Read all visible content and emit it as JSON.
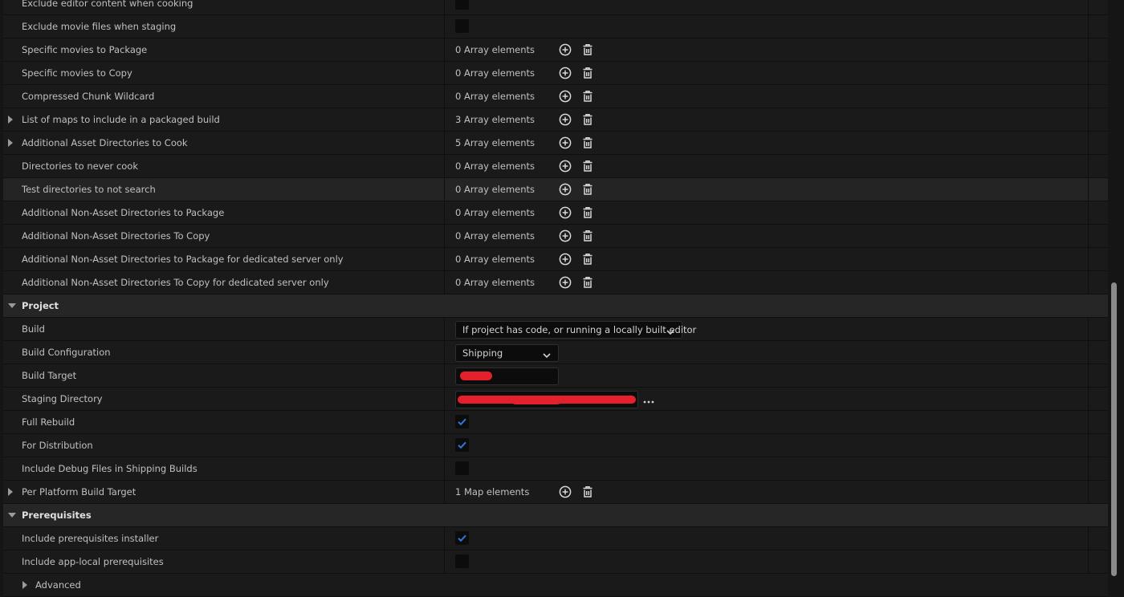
{
  "packaging_rows": [
    {
      "label": "Exclude editor content when cooking",
      "type": "checkbox",
      "checked": false
    },
    {
      "label": "Exclude movie files when staging",
      "type": "checkbox",
      "checked": false
    },
    {
      "label": "Specific movies to Package",
      "type": "array",
      "value": "0 Array elements"
    },
    {
      "label": "Specific movies to Copy",
      "type": "array",
      "value": "0 Array elements"
    },
    {
      "label": "Compressed Chunk Wildcard",
      "type": "array",
      "value": "0 Array elements"
    },
    {
      "label": "List of maps to include in a packaged build",
      "type": "array",
      "value": "3 Array elements",
      "expandable": true
    },
    {
      "label": "Additional Asset Directories to Cook",
      "type": "array",
      "value": "5 Array elements",
      "expandable": true
    },
    {
      "label": "Directories to never cook",
      "type": "array",
      "value": "0 Array elements"
    },
    {
      "label": "Test directories to not search",
      "type": "array",
      "value": "0 Array elements",
      "highlighted": true
    },
    {
      "label": "Additional Non-Asset Directories to Package",
      "type": "array",
      "value": "0 Array elements"
    },
    {
      "label": "Additional Non-Asset Directories To Copy",
      "type": "array",
      "value": "0 Array elements"
    },
    {
      "label": "Additional Non-Asset Directories to Package for dedicated server only",
      "type": "array",
      "value": "0 Array elements"
    },
    {
      "label": "Additional Non-Asset Directories To Copy for dedicated server only",
      "type": "array",
      "value": "0 Array elements"
    }
  ],
  "project": {
    "section_label": "Project",
    "build": {
      "label": "Build",
      "value": "If project has code, or running a locally built editor"
    },
    "build_configuration": {
      "label": "Build Configuration",
      "value": "Shipping"
    },
    "build_target": {
      "label": "Build Target"
    },
    "staging_directory": {
      "label": "Staging Directory",
      "browse": "..."
    },
    "full_rebuild": {
      "label": "Full Rebuild",
      "checked": true
    },
    "for_distribution": {
      "label": "For Distribution",
      "checked": true
    },
    "include_debug_files": {
      "label": "Include Debug Files in Shipping Builds",
      "checked": false
    },
    "per_platform_build_target": {
      "label": "Per Platform Build Target",
      "value": "1 Map elements"
    }
  },
  "prerequisites": {
    "section_label": "Prerequisites",
    "include_installer": {
      "label": "Include prerequisites installer",
      "checked": true
    },
    "include_app_local": {
      "label": "Include app-local prerequisites",
      "checked": false
    }
  },
  "advanced": {
    "label": "Advanced"
  },
  "icons": {
    "add": "add-circle-icon",
    "delete": "trash-icon",
    "check": "checkmark-icon",
    "expand": "triangle-right-icon",
    "collapse": "triangle-down-icon",
    "dropdown": "chevron-down-icon"
  },
  "colors": {
    "check_accent": "#2f78d9",
    "redaction": "#e3202c",
    "panel_bg": "#1a1a1a",
    "section_bg": "#262626"
  }
}
